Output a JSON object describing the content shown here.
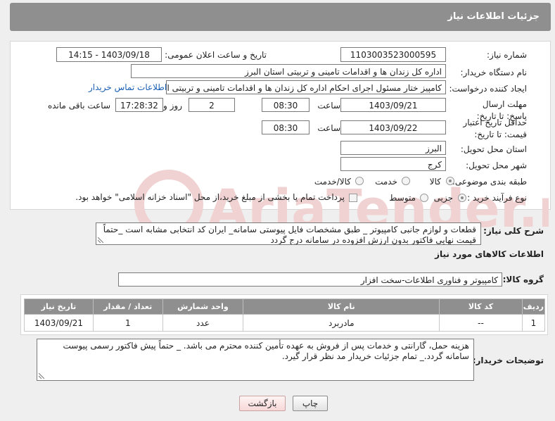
{
  "header": {
    "title": "جزئیات اطلاعات نیاز"
  },
  "form": {
    "need_number_label": "شماره نیاز:",
    "need_number": "1103003523000595",
    "announce_label": "تاریخ و ساعت اعلان عمومی:",
    "announce_value": "1403/09/18 - 14:15",
    "buyer_org_label": "نام دستگاه خریدار:",
    "buyer_org": "اداره کل زندان ها و اقدامات تامینی و تربیتی استان البرز",
    "creator_label": "ایجاد کننده درخواست:",
    "creator": "کامپیز ختار مسئول اجرای احکام اداره کل زندان ها و اقدامات تامینی و تربیتی استان البرز",
    "buyer_contact_link": "اطلاعات تماس خریدار",
    "deadline_label": "مهلت ارسال پاسخ: تا تاریخ:",
    "deadline_date": "1403/09/21",
    "time_label": "ساعت",
    "deadline_time": "08:30",
    "days_value": "2",
    "days_label": "روز و",
    "remaining_time": "17:28:32",
    "remaining_label": "ساعت باقی مانده",
    "validity_label": "حداقل تاریخ اعتبار قیمت: تا تاریخ:",
    "validity_date": "1403/09/22",
    "validity_time": "08:30",
    "province_label": "استان محل تحویل:",
    "province": "البرز",
    "city_label": "شهر محل تحویل:",
    "city": "کرج",
    "category_label": "طبقه بندی موضوعی:",
    "category_options": [
      "کالا",
      "خدمت",
      "کالا/خدمت"
    ],
    "process_label": "نوع فرآیند خرید :",
    "process_options": [
      "جزیی",
      "متوسط"
    ],
    "payment_note": "پرداخت تمام یا بخشی از مبلغ خرید،از محل \"اسناد خزانه اسلامی\" خواهد بود."
  },
  "description": {
    "label": "شرح کلی نیاز:",
    "text": "قطعات و لوازم جانبی کامپیوتر _ طبق مشخصات فایل پیوستی سامانه_ ایران کد انتخابی مشابه است _حتماً قیمت نهایی فاکتور بدون ارزش افزوده در سامانه درج گردد"
  },
  "goods": {
    "section_title": "اطلاعات کالاهای مورد نیاز",
    "group_label": "گروه کالا:",
    "group_value": "کامپیوتر و فناوری اطلاعات-سخت افزار",
    "columns": [
      "ردیف",
      "کد کالا",
      "نام کالا",
      "واحد شمارش",
      "تعداد / مقدار",
      "تاریخ نیاز"
    ],
    "rows": [
      {
        "row": "1",
        "code": "--",
        "name": "مادربرد",
        "unit": "عدد",
        "qty": "1",
        "date": "1403/09/21"
      }
    ]
  },
  "buyer_notes": {
    "label": "توضیحات خریدار:",
    "text": "هزینه حمل، گارانتی و خدمات پس از فروش به عهده تأمین کننده محترم می باشد. _ حتماً پیش فاکتور رسمی پیوست سامانه گردد._ تمام جزئیات خریدار مد نظر قرار گیرد."
  },
  "buttons": {
    "print": "چاپ",
    "back": "بازگشت"
  },
  "colors": {
    "header_bg": "#8f8f8f",
    "link": "#1a5fb4",
    "watermark": "#f0d2d2"
  }
}
